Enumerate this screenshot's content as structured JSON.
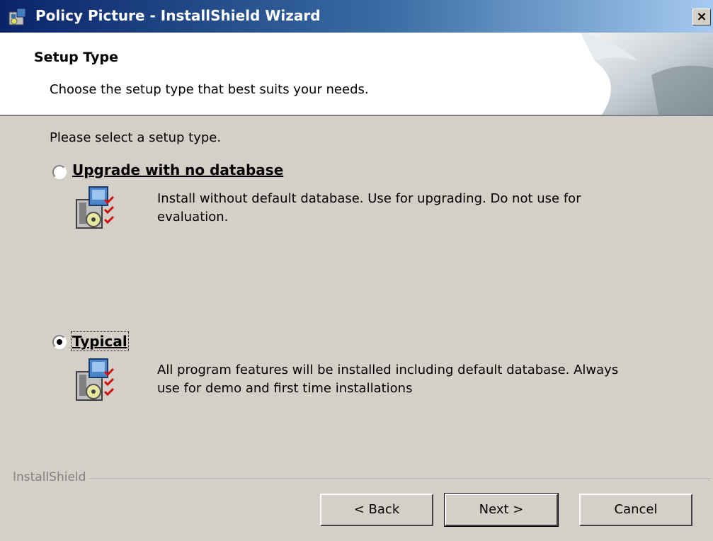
{
  "window": {
    "title": "Policy Picture - InstallShield Wizard",
    "close_glyph": "×"
  },
  "header": {
    "title": "Setup Type",
    "subtitle": "Choose the setup type that best suits your needs."
  },
  "main": {
    "prompt": "Please select a setup type.",
    "options": [
      {
        "label": "Upgrade with no database",
        "selected": false,
        "description": "Install without default database. Use for upgrading. Do not use for evaluation."
      },
      {
        "label": "Typical",
        "selected": true,
        "description": "All program features will be installed including default database. Always use for demo and first time installations"
      }
    ]
  },
  "footer": {
    "brand": "InstallShield",
    "back_label": "< Back",
    "next_label": "Next >",
    "cancel_label": "Cancel"
  },
  "colors": {
    "titlebar_start": "#0a246a",
    "titlebar_end": "#a6caf0",
    "face": "#d4d0c8"
  }
}
